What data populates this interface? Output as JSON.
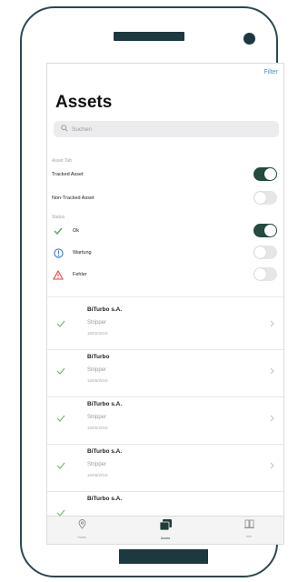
{
  "header": {
    "filter_label": "Filter",
    "title": "Assets"
  },
  "search": {
    "placeholder": "Suchen"
  },
  "asset_tab": {
    "section_label": "Asset Tab",
    "rows": [
      {
        "label": "Tracked Asset",
        "on": true
      },
      {
        "label": "Non-Tracked Asset",
        "on": false
      }
    ]
  },
  "status": {
    "section_label": "Status",
    "rows": [
      {
        "label": "Ok",
        "icon": "check-icon",
        "color": "#4caf50",
        "on": true
      },
      {
        "label": "Wartung",
        "icon": "info-circle-icon",
        "color": "#3a73d9",
        "on": false
      },
      {
        "label": "Fehler",
        "icon": "warning-triangle-icon",
        "color": "#e0434b",
        "on": false
      }
    ]
  },
  "assets": [
    {
      "name": "BiTurbo s.A.",
      "type": "Stripper",
      "date": "16/02/2019"
    },
    {
      "name": "BiTurbo",
      "type": "Stripper",
      "date": "16/06/2019"
    },
    {
      "name": "BiTurbo s.A.",
      "type": "Stripper",
      "date": "16/06/2019"
    },
    {
      "name": "BiTurbo s.A.",
      "type": "Stripper",
      "date": "16/06/2019"
    },
    {
      "name": "BiTurbo s.A.",
      "type": "",
      "date": ""
    }
  ],
  "tabbar": {
    "tabs": [
      {
        "label": "Home",
        "icon": "location-pin-icon",
        "active": false
      },
      {
        "label": "Assets",
        "icon": "assets-stack-icon",
        "active": true
      },
      {
        "label": "Info",
        "icon": "building-icon",
        "active": false
      }
    ]
  },
  "colors": {
    "frame": "#2b4850",
    "toggle_on": "#234b3f",
    "accent": "#4a8fd6"
  }
}
